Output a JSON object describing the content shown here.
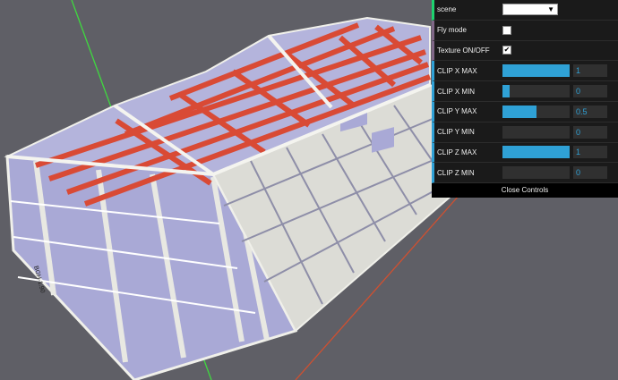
{
  "viewport": {
    "drawing_label": "BGH-1.90",
    "colors": {
      "background": "#5f5f66",
      "wall": "#a9a9d6",
      "frame": "#e6e6e0",
      "beam_highlight": "#d94a35",
      "axis_green": "#3fd93f",
      "axis_red": "#d05030"
    }
  },
  "controls": {
    "accent_number": "#2fa1d6",
    "accent_bool": "#806787",
    "accent_string": "#1ed36f",
    "scene": {
      "label": "scene",
      "value": ""
    },
    "fly_mode": {
      "label": "Fly mode",
      "checked": false
    },
    "texture": {
      "label": "Texture ON/OFF",
      "checked": true
    },
    "sliders": [
      {
        "label": "CLIP X MAX",
        "value": "1",
        "fraction": 1.0
      },
      {
        "label": "CLIP X MIN",
        "value": "0",
        "fraction": 0.1
      },
      {
        "label": "CLIP Y MAX",
        "value": "0.5",
        "fraction": 0.5
      },
      {
        "label": "CLIP Y MIN",
        "value": "0",
        "fraction": 0.0
      },
      {
        "label": "CLIP Z MAX",
        "value": "1",
        "fraction": 1.0
      },
      {
        "label": "CLIP Z MIN",
        "value": "0",
        "fraction": 0.0
      }
    ],
    "close_label": "Close Controls"
  }
}
